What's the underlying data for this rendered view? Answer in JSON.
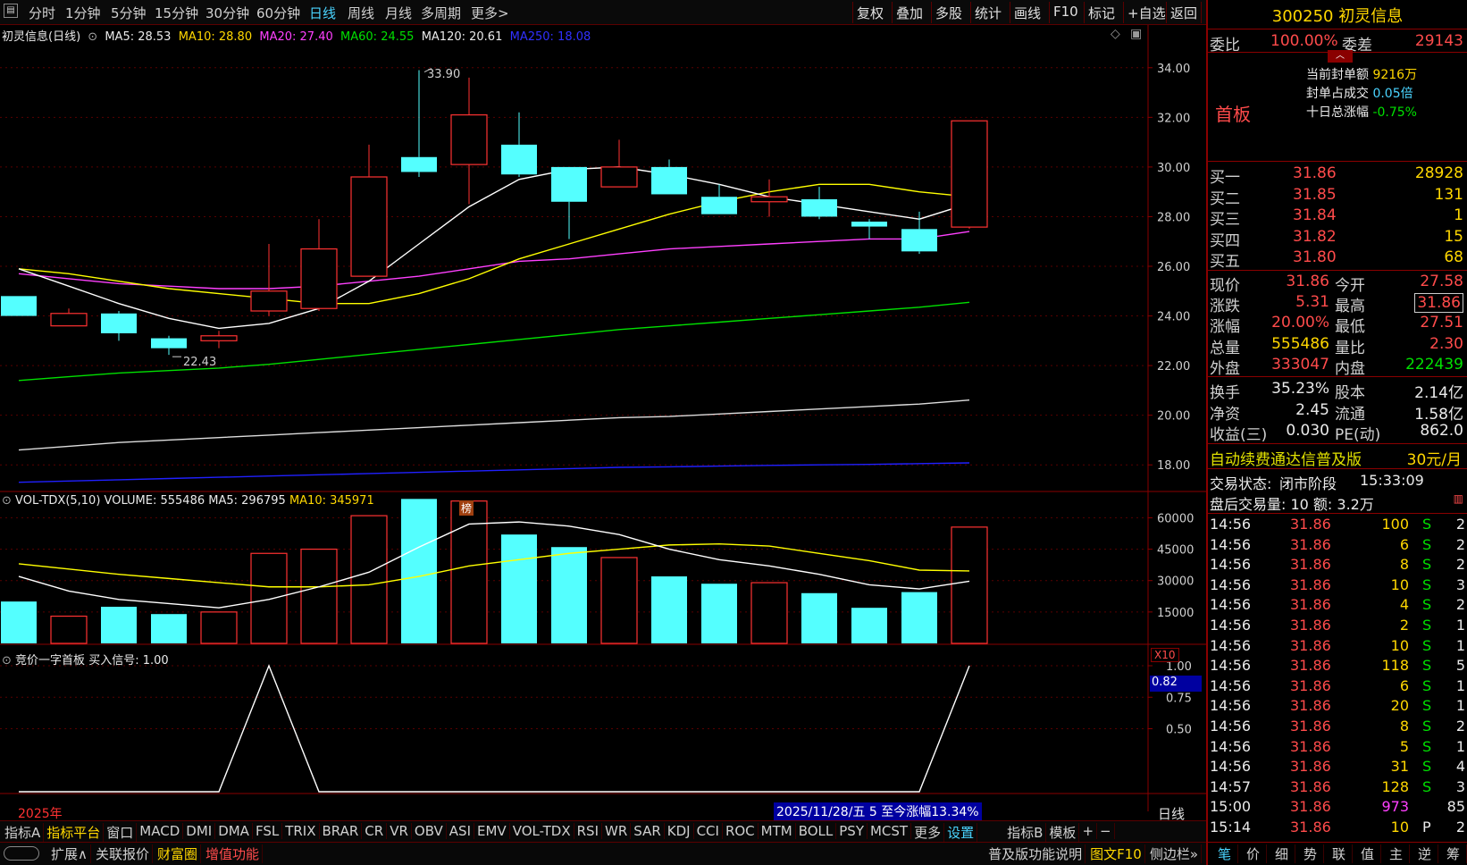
{
  "topbar": {
    "menu_icon": "menu-icon",
    "tabs": [
      "分时",
      "1分钟",
      "5分钟",
      "15分钟",
      "30分钟",
      "60分钟",
      "日线",
      "周线",
      "月线",
      "多周期",
      "更多>"
    ],
    "active_tab": "日线",
    "right_buttons": [
      "复权",
      "叠加",
      "多股",
      "统计",
      "画线",
      "F10",
      "标记",
      "+自选",
      "返回"
    ]
  },
  "main_header": {
    "title": "初灵信息(日线)",
    "ma5": "MA5: 28.53",
    "ma10": "MA10: 28.80",
    "ma20": "MA20: 27.40",
    "ma60": "MA60: 24.55",
    "ma120": "MA120: 20.61",
    "ma250": "MA250: 18.08"
  },
  "annotations": {
    "high": "33.90",
    "low": "22.43",
    "bang": "榜"
  },
  "price_axis": [
    "34.00",
    "32.00",
    "30.00",
    "28.00",
    "26.00",
    "24.00",
    "22.00",
    "20.00",
    "18.00"
  ],
  "volume_header": {
    "title": "VOL-TDX(5,10)",
    "volume": "VOLUME: 555486",
    "ma5": "MA5: 296795",
    "ma10": "MA10: 345971"
  },
  "volume_axis": [
    "60000",
    "45000",
    "30000",
    "15000"
  ],
  "volume_unit": "X10",
  "signal_header": {
    "title": "竞价一字首板",
    "signal": "买入信号: 1.00"
  },
  "signal_axis": [
    "1.00",
    "0.75",
    "0.50"
  ],
  "signal_current": "0.82",
  "year_label": "2025年",
  "date_info": "2025/11/28/五 5 至今涨幅13.34%",
  "period_label": "日线",
  "chart_data": {
    "type": "candlestick",
    "candles": [
      {
        "o": 24.8,
        "c": 24.0,
        "h": 24.8,
        "l": 24.0,
        "up": false
      },
      {
        "o": 23.6,
        "c": 24.1,
        "h": 24.3,
        "l": 23.6,
        "up": true
      },
      {
        "o": 24.1,
        "c": 23.3,
        "h": 24.2,
        "l": 23.0,
        "up": false
      },
      {
        "o": 23.1,
        "c": 22.7,
        "h": 23.2,
        "l": 22.43,
        "up": false
      },
      {
        "o": 23.0,
        "c": 23.2,
        "h": 23.4,
        "l": 22.7,
        "up": true
      },
      {
        "o": 24.2,
        "c": 25.0,
        "h": 26.9,
        "l": 24.0,
        "up": true
      },
      {
        "o": 24.3,
        "c": 26.7,
        "h": 27.9,
        "l": 24.2,
        "up": true
      },
      {
        "o": 25.6,
        "c": 29.6,
        "h": 30.9,
        "l": 25.6,
        "up": true
      },
      {
        "o": 29.8,
        "c": 30.4,
        "h": 33.9,
        "l": 29.6,
        "up": false
      },
      {
        "o": 30.1,
        "c": 32.1,
        "h": 33.6,
        "l": 28.5,
        "up": true
      },
      {
        "o": 30.9,
        "c": 29.7,
        "h": 32.2,
        "l": 29.6,
        "up": false
      },
      {
        "o": 30.0,
        "c": 28.6,
        "h": 30.0,
        "l": 27.1,
        "up": false
      },
      {
        "o": 29.2,
        "c": 30.0,
        "h": 31.1,
        "l": 29.2,
        "up": true
      },
      {
        "o": 30.0,
        "c": 28.9,
        "h": 30.3,
        "l": 28.9,
        "up": false
      },
      {
        "o": 28.8,
        "c": 28.1,
        "h": 29.3,
        "l": 28.1,
        "up": false
      },
      {
        "o": 28.6,
        "c": 28.8,
        "h": 29.5,
        "l": 28.0,
        "up": true
      },
      {
        "o": 28.7,
        "c": 28.0,
        "h": 29.2,
        "l": 27.9,
        "up": false
      },
      {
        "o": 27.8,
        "c": 27.6,
        "h": 27.9,
        "l": 27.1,
        "up": false
      },
      {
        "o": 27.5,
        "c": 26.6,
        "h": 28.2,
        "l": 26.5,
        "up": false
      },
      {
        "o": 27.58,
        "c": 31.86,
        "h": 31.86,
        "l": 27.51,
        "up": true
      }
    ],
    "ma5": [
      25.9,
      25.2,
      24.5,
      23.9,
      23.5,
      23.7,
      24.3,
      25.4,
      26.9,
      28.4,
      29.5,
      29.9,
      30.0,
      29.7,
      29.3,
      28.8,
      28.5,
      28.2,
      27.9,
      28.53
    ],
    "ma10": [
      25.9,
      25.7,
      25.4,
      25.1,
      24.9,
      24.7,
      24.5,
      24.5,
      24.9,
      25.5,
      26.3,
      26.9,
      27.5,
      28.1,
      28.6,
      29.0,
      29.3,
      29.3,
      29.0,
      28.8
    ],
    "ma20": [
      25.7,
      25.5,
      25.3,
      25.2,
      25.1,
      25.1,
      25.2,
      25.4,
      25.6,
      25.9,
      26.2,
      26.3,
      26.5,
      26.7,
      26.8,
      26.9,
      27.0,
      27.1,
      27.1,
      27.4
    ],
    "ma60": [
      21.4,
      21.55,
      21.7,
      21.8,
      21.9,
      22.05,
      22.25,
      22.45,
      22.65,
      22.85,
      23.05,
      23.25,
      23.45,
      23.6,
      23.75,
      23.9,
      24.05,
      24.2,
      24.35,
      24.55
    ],
    "ma120": [
      18.6,
      18.75,
      18.9,
      19.0,
      19.1,
      19.2,
      19.3,
      19.4,
      19.5,
      19.6,
      19.7,
      19.8,
      19.9,
      19.95,
      20.05,
      20.15,
      20.25,
      20.35,
      20.45,
      20.61
    ],
    "ma250": [
      17.3,
      17.35,
      17.4,
      17.45,
      17.5,
      17.55,
      17.6,
      17.65,
      17.7,
      17.75,
      17.8,
      17.85,
      17.9,
      17.92,
      17.95,
      17.98,
      18.0,
      18.02,
      18.05,
      18.08
    ],
    "price_range": [
      17.0,
      35.0
    ],
    "volume": [
      20000,
      13000,
      17500,
      14000,
      15000,
      43000,
      45000,
      61000,
      69000,
      68000,
      52000,
      46000,
      41000,
      32000,
      28500,
      29000,
      24000,
      17000,
      24500,
      55549
    ],
    "volume_ma5": [
      32000,
      25000,
      21000,
      19000,
      17000,
      21000,
      27000,
      34000,
      46000,
      57000,
      58000,
      56000,
      52000,
      45000,
      40000,
      37000,
      33000,
      28000,
      26000,
      29680
    ],
    "volume_ma10": [
      38000,
      35500,
      33000,
      31000,
      29000,
      27000,
      27000,
      28000,
      32000,
      37000,
      40000,
      43000,
      45000,
      47000,
      47500,
      46500,
      43000,
      39500,
      35000,
      34597
    ],
    "volume_range": [
      0,
      70000
    ],
    "signal": [
      0,
      0,
      0,
      0,
      0,
      1,
      0,
      0,
      0,
      0,
      0,
      0,
      0,
      0,
      0,
      0,
      0,
      0,
      0,
      1
    ],
    "signal_range": [
      0,
      1
    ]
  },
  "bottom_tabs1": [
    "指标A",
    "指标平台",
    "窗口",
    "MACD",
    "DMI",
    "DMA",
    "FSL",
    "TRIX",
    "BRAR",
    "CR",
    "VR",
    "OBV",
    "ASI",
    "EMV",
    "VOL-TDX",
    "RSI",
    "WR",
    "SAR",
    "KDJ",
    "CCI",
    "ROC",
    "MTM",
    "BOLL",
    "PSY",
    "MCST",
    "更多",
    "设置",
    "指标B",
    "模板",
    "+",
    "−"
  ],
  "bottom_tabs2": [
    "扩展∧",
    "关联报价",
    "财富圈",
    "增值功能"
  ],
  "bottom_right2": [
    "普及版功能说明",
    "图文F10",
    "侧边栏»"
  ],
  "right_panel": {
    "code": "300250",
    "name": "初灵信息",
    "weibi_label": "委比",
    "weibi": "100.00%",
    "weicha_label": "委差",
    "weicha": "29143",
    "board_label": "首板",
    "seal_amount_label": "当前封单额",
    "seal_amount": "9216万",
    "seal_ratio_label": "封单占成交",
    "seal_ratio": "0.05倍",
    "ten_day_label": "十日总涨幅",
    "ten_day": "-0.75%",
    "bids": [
      {
        "label": "买一",
        "price": "31.86",
        "vol": "28928"
      },
      {
        "label": "买二",
        "price": "31.85",
        "vol": "131"
      },
      {
        "label": "买三",
        "price": "31.84",
        "vol": "1"
      },
      {
        "label": "买四",
        "price": "31.82",
        "vol": "15"
      },
      {
        "label": "买五",
        "price": "31.80",
        "vol": "68"
      }
    ],
    "stats": [
      {
        "l1": "现价",
        "v1": "31.86",
        "c1": "red",
        "l2": "今开",
        "v2": "27.58",
        "c2": "red"
      },
      {
        "l1": "涨跌",
        "v1": "5.31",
        "c1": "red",
        "l2": "最高",
        "v2": "31.86",
        "c2": "red"
      },
      {
        "l1": "涨幅",
        "v1": "20.00%",
        "c1": "red",
        "l2": "最低",
        "v2": "27.51",
        "c2": "red"
      },
      {
        "l1": "总量",
        "v1": "555486",
        "c1": "yellow",
        "l2": "量比",
        "v2": "2.30",
        "c2": "red"
      },
      {
        "l1": "外盘",
        "v1": "333047",
        "c1": "red",
        "l2": "内盘",
        "v2": "222439",
        "c2": "green"
      }
    ],
    "fundamentals": [
      {
        "l1": "换手",
        "v1": "35.23%",
        "l2": "股本",
        "v2": "2.14亿"
      },
      {
        "l1": "净资",
        "v1": "2.45",
        "l2": "流通",
        "v2": "1.58亿"
      },
      {
        "l1": "收益(三)",
        "v1": "0.030",
        "l2": "PE(动)",
        "v2": "862.0"
      }
    ],
    "promo": "自动续费通达信普及版",
    "promo_price": "30元/月",
    "trade_status_label": "交易状态:",
    "trade_status": "闭市阶段",
    "trade_time": "15:33:09",
    "after_hours": "盘后交易量: 10  额: 3.2万",
    "trades": [
      {
        "t": "14:56",
        "p": "31.86",
        "v": "100",
        "s": "S",
        "n": "2"
      },
      {
        "t": "14:56",
        "p": "31.86",
        "v": "6",
        "s": "S",
        "n": "2"
      },
      {
        "t": "14:56",
        "p": "31.86",
        "v": "8",
        "s": "S",
        "n": "2"
      },
      {
        "t": "14:56",
        "p": "31.86",
        "v": "10",
        "s": "S",
        "n": "3"
      },
      {
        "t": "14:56",
        "p": "31.86",
        "v": "4",
        "s": "S",
        "n": "2"
      },
      {
        "t": "14:56",
        "p": "31.86",
        "v": "2",
        "s": "S",
        "n": "1"
      },
      {
        "t": "14:56",
        "p": "31.86",
        "v": "10",
        "s": "S",
        "n": "1"
      },
      {
        "t": "14:56",
        "p": "31.86",
        "v": "118",
        "s": "S",
        "n": "5"
      },
      {
        "t": "14:56",
        "p": "31.86",
        "v": "6",
        "s": "S",
        "n": "1"
      },
      {
        "t": "14:56",
        "p": "31.86",
        "v": "20",
        "s": "S",
        "n": "1"
      },
      {
        "t": "14:56",
        "p": "31.86",
        "v": "8",
        "s": "S",
        "n": "2"
      },
      {
        "t": "14:56",
        "p": "31.86",
        "v": "5",
        "s": "S",
        "n": "1"
      },
      {
        "t": "14:56",
        "p": "31.86",
        "v": "31",
        "s": "S",
        "n": "4"
      },
      {
        "t": "14:57",
        "p": "31.86",
        "v": "128",
        "s": "S",
        "n": "3"
      },
      {
        "t": "15:00",
        "p": "31.86",
        "v": "973",
        "s": "",
        "n": "85"
      },
      {
        "t": "15:14",
        "p": "31.86",
        "v": "10",
        "s": "P",
        "n": "2"
      }
    ],
    "bottom_tabs": [
      "笔",
      "价",
      "细",
      "势",
      "联",
      "值",
      "主",
      "逆",
      "筹"
    ]
  },
  "colors": {
    "up": "#ff3232",
    "down": "#54ffff",
    "ma5": "#ffffff",
    "ma10": "#ffff00",
    "ma20": "#ff40ff",
    "ma60": "#00e000",
    "ma120": "#dddddd",
    "ma250": "#2020ff"
  }
}
